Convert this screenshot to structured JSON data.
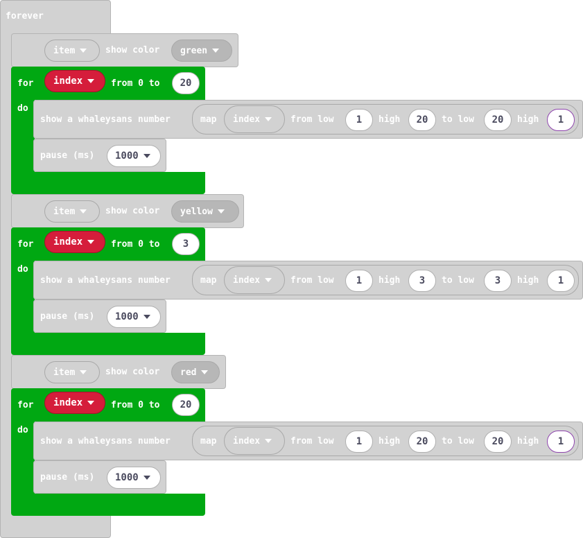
{
  "forever_label": "forever",
  "groups": [
    {
      "item_label": "item",
      "show_color_label": "show color",
      "color": "green",
      "for_label": "for",
      "var": "index",
      "from_label": "from 0 to",
      "to_value": "20",
      "do_label": "do",
      "show_label": "show a whaleysans number",
      "map_label": "map",
      "map_var": "index",
      "from_low_label": "from low",
      "from_low": "1",
      "high_label": "high",
      "from_high": "20",
      "to_low_label": "to low",
      "to_low": "20",
      "to_high": "1",
      "pause_label": "pause (ms)",
      "pause_value": "1000"
    },
    {
      "item_label": "item",
      "show_color_label": "show color",
      "color": "yellow",
      "for_label": "for",
      "var": "index",
      "from_label": "from 0 to",
      "to_value": "3",
      "do_label": "do",
      "show_label": "show a whaleysans number",
      "map_label": "map",
      "map_var": "index",
      "from_low_label": "from low",
      "from_low": "1",
      "high_label": "high",
      "from_high": "3",
      "to_low_label": "to low",
      "to_low": "3",
      "to_high": "1",
      "pause_label": "pause (ms)",
      "pause_value": "1000"
    },
    {
      "item_label": "item",
      "show_color_label": "show color",
      "color": "red",
      "for_label": "for",
      "var": "index",
      "from_label": "from 0 to",
      "to_value": "20",
      "do_label": "do",
      "show_label": "show a whaleysans number",
      "map_label": "map",
      "map_var": "index",
      "from_low_label": "from low",
      "from_low": "1",
      "high_label": "high",
      "from_high": "20",
      "to_low_label": "to low",
      "to_low": "20",
      "to_high": "1",
      "pause_label": "pause (ms)",
      "pause_value": "1000"
    }
  ],
  "colors": {
    "block_gray": "#d2d2d2",
    "loop_green": "#00a812",
    "variable_red": "#d51d3b",
    "input_white": "#ffffff",
    "value_text": "#4a4a5e"
  }
}
